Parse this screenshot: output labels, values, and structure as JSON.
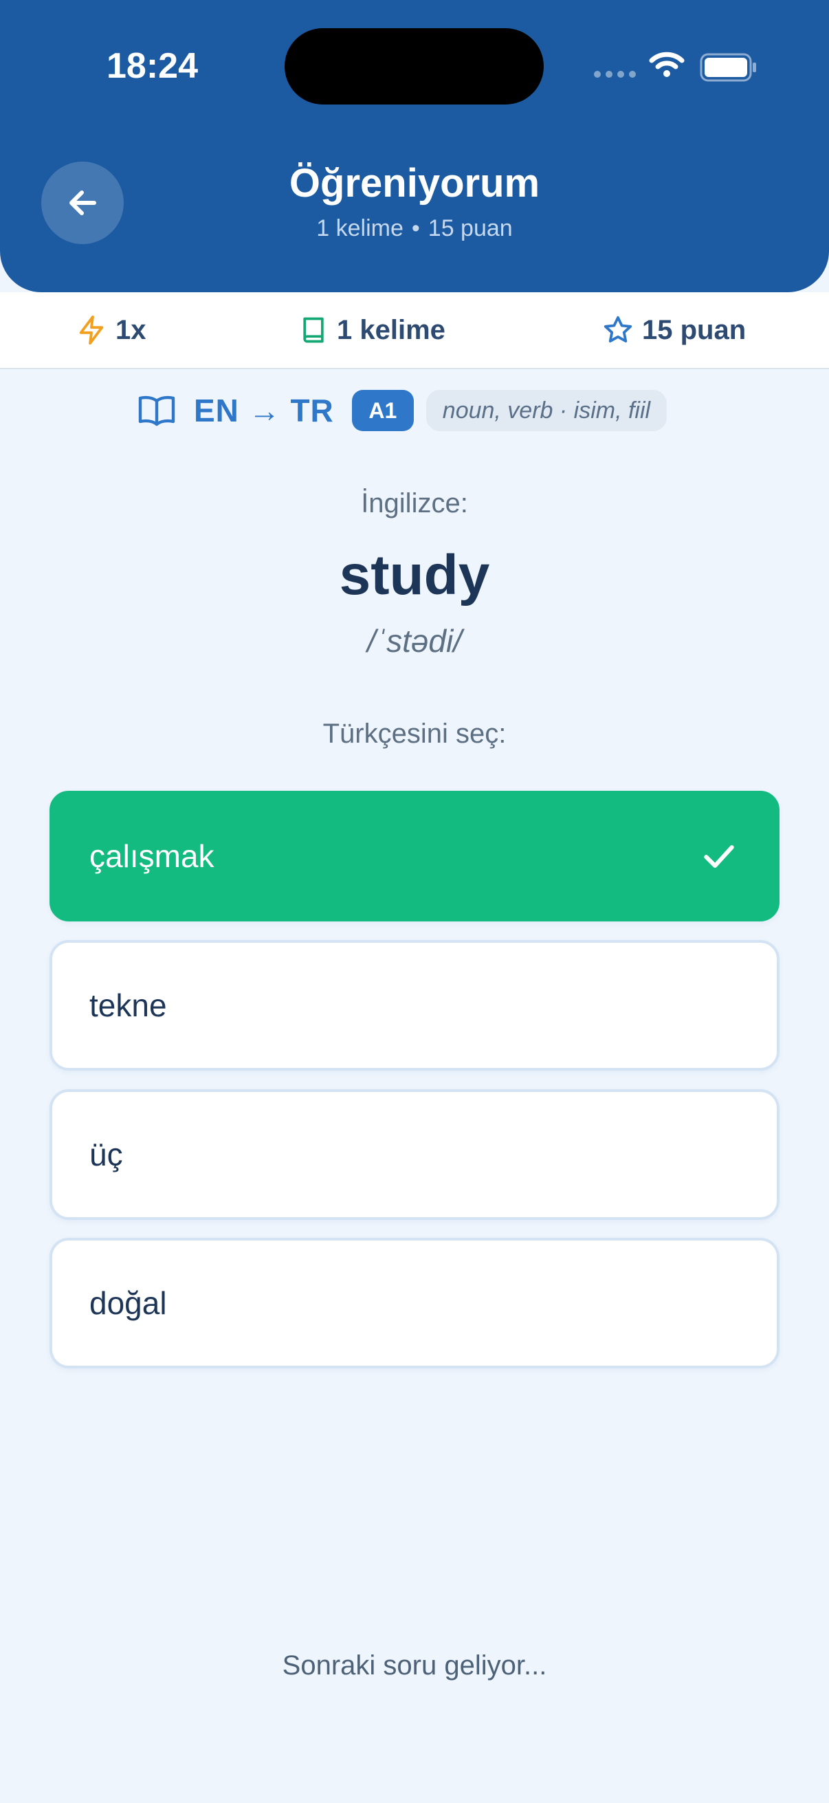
{
  "status_bar": {
    "time": "18:24"
  },
  "header": {
    "title": "Öğreniyorum",
    "subtitle_words": "1 kelime",
    "subtitle_separator": "•",
    "subtitle_points": "15 puan"
  },
  "stats": {
    "multiplier": "1x",
    "words": "1 kelime",
    "points": "15 puan"
  },
  "quiz": {
    "direction": "EN → TR",
    "level": "A1",
    "part_of_speech": "noun, verb · isim, fiil",
    "source_language_label": "İngilizce:",
    "word": "study",
    "phonetic": "/ˈstədi/",
    "instruction": "Türkçesini seç:",
    "options": [
      {
        "label": "çalışmak",
        "state": "correct"
      },
      {
        "label": "tekne",
        "state": "default"
      },
      {
        "label": "üç",
        "state": "default"
      },
      {
        "label": "doğal",
        "state": "default"
      }
    ]
  },
  "footer": {
    "message": "Sonraki soru geliyor..."
  },
  "colors": {
    "header": "#1c5ba2",
    "accent": "#2f78c9",
    "correct": "#13bb80",
    "background": "#eef5fd"
  },
  "icons": {
    "back": "arrow-left-icon",
    "multiplier": "lightning-icon",
    "words": "book-icon",
    "points": "star-icon",
    "direction": "open-book-icon",
    "correct": "check-icon"
  }
}
